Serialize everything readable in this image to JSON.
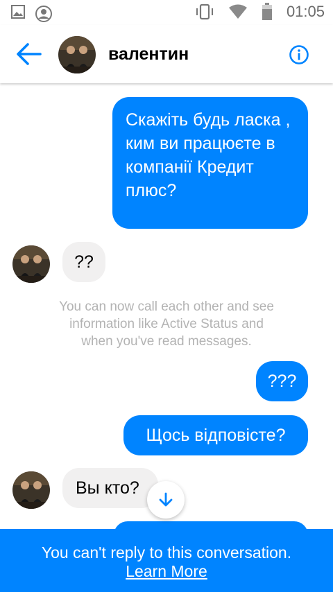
{
  "status_bar": {
    "time": "01:05"
  },
  "header": {
    "contact_name": "валентин",
    "icons": {
      "back": "back-arrow-icon",
      "info": "info-icon"
    },
    "accent_color": "#0084ff"
  },
  "messages": [
    {
      "direction": "outgoing",
      "text": "Скажіть будь ласка , ким ви працюєте в компанії Кредит плюс?"
    },
    {
      "direction": "incoming",
      "text": "??"
    },
    {
      "direction": "outgoing",
      "text": "???"
    },
    {
      "direction": "outgoing",
      "text": "Щось відповісте?"
    },
    {
      "direction": "incoming",
      "text": "Вы кто?"
    }
  ],
  "notice": "You can now call each other and see information like Active Status and when you've read messages.",
  "footer": {
    "message": "You can't reply to this conversation.",
    "link": "Learn More"
  }
}
